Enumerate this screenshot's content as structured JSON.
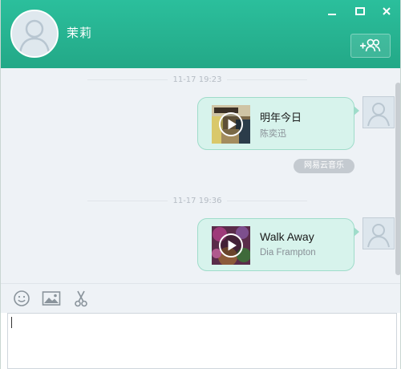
{
  "header": {
    "contact_name": "茉莉",
    "accent_color": "#26b290",
    "icons": [
      "minimize-icon",
      "maximize-icon",
      "close-icon",
      "add-friends-icon"
    ]
  },
  "messages": [
    {
      "timestamp": "11-17 19:23",
      "type": "music-share",
      "title": "明年今日",
      "artist": "陈奕迅",
      "source_tag": "网易云音乐"
    },
    {
      "timestamp": "11-17 19:36",
      "type": "music-share",
      "title": "Walk Away",
      "artist": "Dia Frampton"
    }
  ],
  "toolbar": {
    "icons": [
      "emoji-icon",
      "image-icon",
      "scissors-icon"
    ]
  },
  "input": {
    "value": ""
  }
}
